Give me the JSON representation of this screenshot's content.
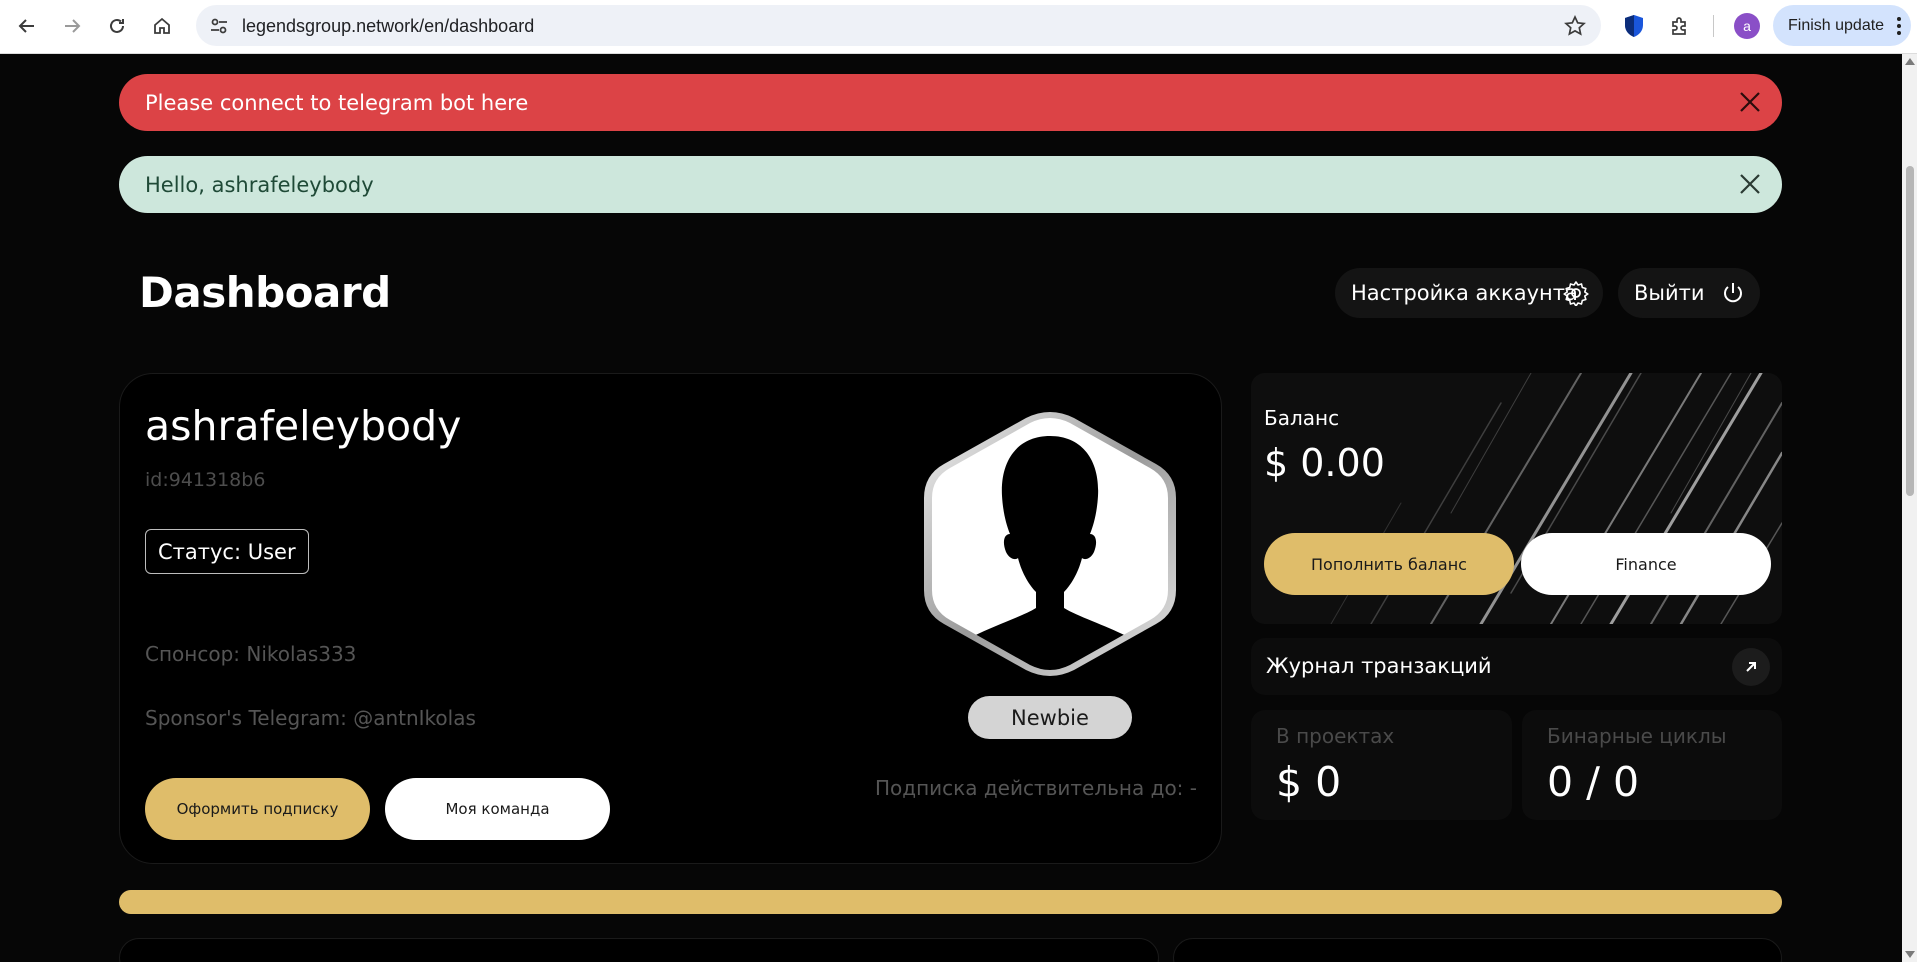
{
  "browser": {
    "url": "legendsgroup.network/en/dashboard",
    "finish_update": "Finish update",
    "profile_initial": "a"
  },
  "alerts": {
    "telegram": "Please connect to telegram bot here",
    "greeting": "Hello, ashrafeleybody"
  },
  "header": {
    "title": "Dashboard",
    "settings_label": "Настройка аккаунта",
    "logout_label": "Выйти"
  },
  "profile": {
    "username": "ashrafeleybody",
    "id": "id:941318b6",
    "status": "Статус: User",
    "sponsor": "Спонсор: Nikolas333",
    "sponsor_telegram": "Sponsor's Telegram: @antnIkolas",
    "subscribe_label": "Оформить подписку",
    "team_label": "Моя команда",
    "rank": "Newbie",
    "subscription_valid": "Подписка действительна до: -"
  },
  "balance": {
    "label": "Баланс",
    "value": "$ 0.00",
    "topup_label": "Пополнить баланс",
    "finance_label": "Finance"
  },
  "transactions": {
    "label": "Журнал транзакций"
  },
  "stats": {
    "projects_label": "В проектах",
    "projects_value": "$ 0",
    "binary_label": "Бинарные циклы",
    "binary_value": "0 / 0"
  },
  "colors": {
    "accent_gold": "#dfbd6a",
    "alert_red": "#dc4346",
    "alert_green": "#cde7dc",
    "background": "#060606"
  }
}
